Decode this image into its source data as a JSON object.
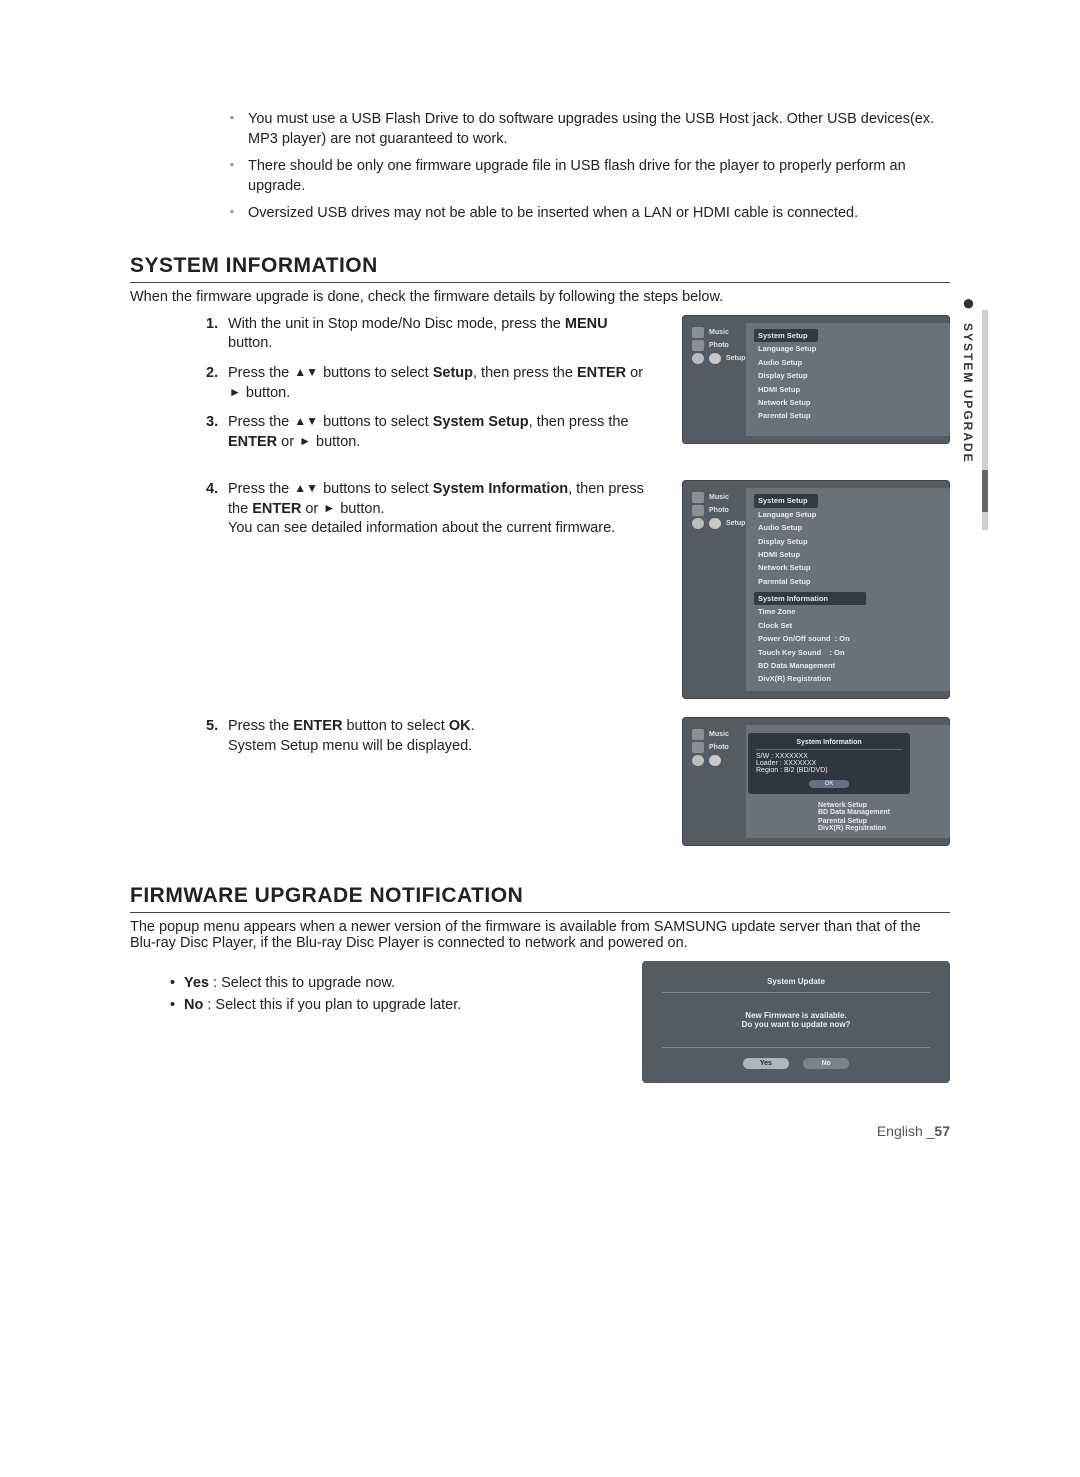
{
  "side_tab": "SYSTEM UPGRADE",
  "notes": [
    "You must use a USB Flash Drive to do software upgrades using the USB Host jack. Other USB devices(ex. MP3 player) are not guaranteed to work.",
    "There should be only one firmware upgrade file in USB flash drive for the player to properly perform an upgrade.",
    "Oversized USB drives may not be able to be inserted when a LAN or HDMI cable is connected."
  ],
  "sec_sysinfo": {
    "heading": "SYSTEM INFORMATION",
    "intro": "When the firmware upgrade is done, check the firmware details by following the steps below.",
    "steps": {
      "s1_pre": "With the unit in Stop mode/No Disc mode, press the ",
      "s1_b": "MENU",
      "s1_post": " button.",
      "s2_pre": "Press the ",
      "s2_ar": "▲▼",
      "s2_mid1": " buttons to select ",
      "s2_b1": "Setup",
      "s2_mid2": ", then press the ",
      "s2_b2": "ENTER",
      "s2_mid3": " or ",
      "s2_ar2": "►",
      "s2_post": " button.",
      "s3_pre": "Press the ",
      "s3_ar": "▲▼",
      "s3_mid1": " buttons to select ",
      "s3_b1": "System Setup",
      "s3_mid2": ", then press the ",
      "s3_b2": "ENTER",
      "s3_mid3": " or ",
      "s3_ar2": "►",
      "s3_post": " button.",
      "s4_pre": "Press the ",
      "s4_ar": "▲▼",
      "s4_mid1": " buttons to select ",
      "s4_b1": "System Information",
      "s4_mid2": ", then press the ",
      "s4_b2": "ENTER",
      "s4_mid3": " or ",
      "s4_ar2": "►",
      "s4_post": " button.",
      "s4_extra": "You can see detailed information about the current firmware.",
      "s5_pre": "Press the ",
      "s5_b1": "ENTER",
      "s5_mid1": " button to select ",
      "s5_b2": "OK",
      "s5_post": ".",
      "s5_extra": "System Setup menu will be displayed."
    }
  },
  "osd": {
    "left": {
      "music": "Music",
      "photo": "Photo",
      "setup": "Setup"
    },
    "menu1": [
      "System Setup",
      "Language Setup",
      "Audio Setup",
      "Display Setup",
      "HDMI Setup",
      "Network Setup",
      "Parental Setup"
    ],
    "menu2_right": {
      "SystemInformation": "System Information",
      "TimeZone": "Time Zone",
      "ClockSet": "Clock Set",
      "PowerOnOff": "Power On/Off sound",
      "PowerOnOff_v": ": On",
      "TouchKey": "Touch Key Sound",
      "TouchKey_v": ": On",
      "BDData": "BD Data Management",
      "DivX": "DivX(R) Registration"
    },
    "modal": {
      "title": "System Information",
      "l1": "S/W : XXXXXXX",
      "l2": "Loader : XXXXXXX",
      "l3": "Region : B/2 (BD/DVD)",
      "ok": "OK"
    },
    "under": {
      "net": "Network Setup",
      "par": "Parental Setup",
      "bd": "BD Data Management",
      "divx": "DivX(R) Registration"
    },
    "update": {
      "title": "System Update",
      "l1": "New Firmware is available.",
      "l2": "Do you want to update now?",
      "yes": "Yes",
      "no": "No"
    }
  },
  "sec_fw": {
    "heading": "FIRMWARE UPGRADE NOTIFICATION",
    "intro": "The popup menu appears when a newer version of the firmware is available from SAMSUNG update server than that of the Blu-ray Disc Player, if the Blu-ray Disc Player is connected to network and powered on.",
    "yes_b": "Yes",
    "yes_t": " : Select this to upgrade now.",
    "no_b": "No",
    "no_t": " : Select this if you plan to upgrade later."
  },
  "footer": {
    "lang": "English _",
    "page": "57"
  }
}
